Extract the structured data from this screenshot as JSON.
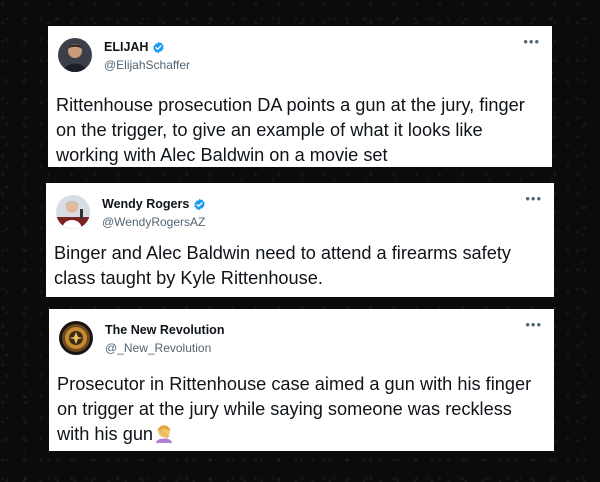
{
  "tweets": [
    {
      "display_name": "ELIJAH",
      "handle": "@ElijahSchaffer",
      "verified": true,
      "avatar_icon": "person-avatar-icon",
      "text": "Rittenhouse prosecution DA points a gun at the jury, finger on the trigger, to give an example of what it looks like working with Alec Baldwin on a movie set",
      "more_icon": "more-options-icon"
    },
    {
      "display_name": "Wendy Rogers",
      "handle": "@WendyRogersAZ",
      "verified": true,
      "avatar_icon": "person-avatar-icon",
      "text": "Binger and Alec Baldwin need to attend a firearms safety class taught by Kyle Rittenhouse.",
      "more_icon": "more-options-icon"
    },
    {
      "display_name": "The New Revolution",
      "handle": "@_New_Revolution",
      "verified": false,
      "avatar_icon": "revolution-logo-avatar-icon",
      "text": "Prosecutor in Rittenhouse case aimed a gun with his finger on trigger at the jury while saying someone was reckless with his gun",
      "emoji": "person-facepalming-emoji",
      "more_icon": "more-options-icon"
    }
  ],
  "colors": {
    "background": "#0b0b0b",
    "card": "#ffffff",
    "text": "#0f1419",
    "secondary_text": "#536471",
    "verified_blue": "#1d9bf0"
  }
}
